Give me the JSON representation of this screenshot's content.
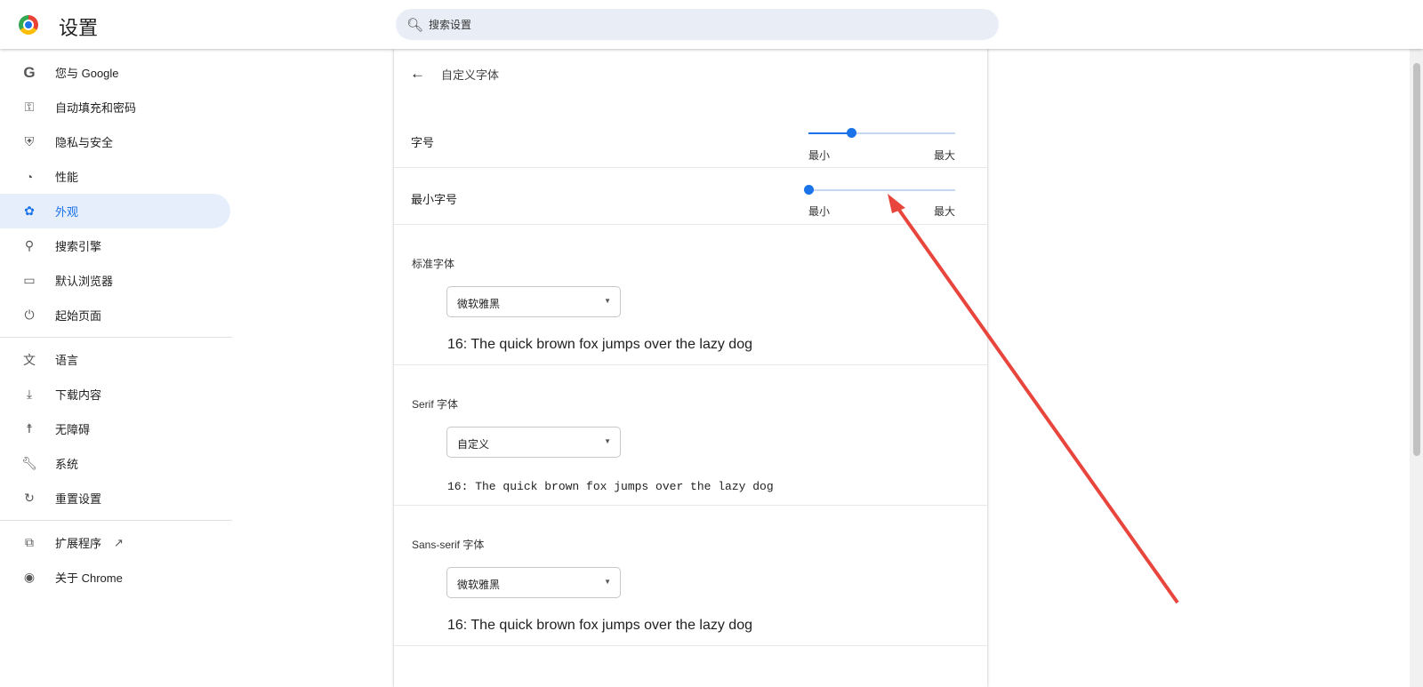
{
  "header": {
    "title": "设置",
    "search_placeholder": "搜索设置"
  },
  "sidebar": {
    "items": [
      {
        "label": "您与 Google",
        "icon": "google-icon"
      },
      {
        "label": "自动填充和密码",
        "icon": "key-icon"
      },
      {
        "label": "隐私与安全",
        "icon": "shield-icon"
      },
      {
        "label": "性能",
        "icon": "speedometer-icon"
      },
      {
        "label": "外观",
        "icon": "palette-icon",
        "active": true
      },
      {
        "label": "搜索引擎",
        "icon": "search-icon"
      },
      {
        "label": "默认浏览器",
        "icon": "browser-icon"
      },
      {
        "label": "起始页面",
        "icon": "power-icon"
      },
      {
        "label": "语言",
        "icon": "translate-icon"
      },
      {
        "label": "下载内容",
        "icon": "download-icon"
      },
      {
        "label": "无障碍",
        "icon": "accessibility-icon"
      },
      {
        "label": "系统",
        "icon": "wrench-icon"
      },
      {
        "label": "重置设置",
        "icon": "reset-icon"
      },
      {
        "label": "扩展程序",
        "icon": "extension-icon"
      },
      {
        "label": "关于 Chrome",
        "icon": "chrome-icon"
      }
    ]
  },
  "panel": {
    "title": "自定义字体",
    "font_size": {
      "label": "字号",
      "min": "最小",
      "max": "最大",
      "value_fraction": 0.29
    },
    "min_font_size": {
      "label": "最小字号",
      "min": "最小",
      "max": "最大",
      "value_fraction": 0.0
    },
    "fonts": [
      {
        "label": "标准字体",
        "value": "微软雅黑",
        "sample": "16: The quick brown fox jumps over the lazy dog"
      },
      {
        "label": "Serif 字体",
        "value": "自定义",
        "sample": "16: The quick brown fox jumps over the lazy dog"
      },
      {
        "label": "Sans-serif 字体",
        "value": "微软雅黑",
        "sample": "16: The quick brown fox jumps over the lazy dog"
      }
    ]
  },
  "colors": {
    "accent": "#1a73e8",
    "annotation": "#e8453c"
  }
}
